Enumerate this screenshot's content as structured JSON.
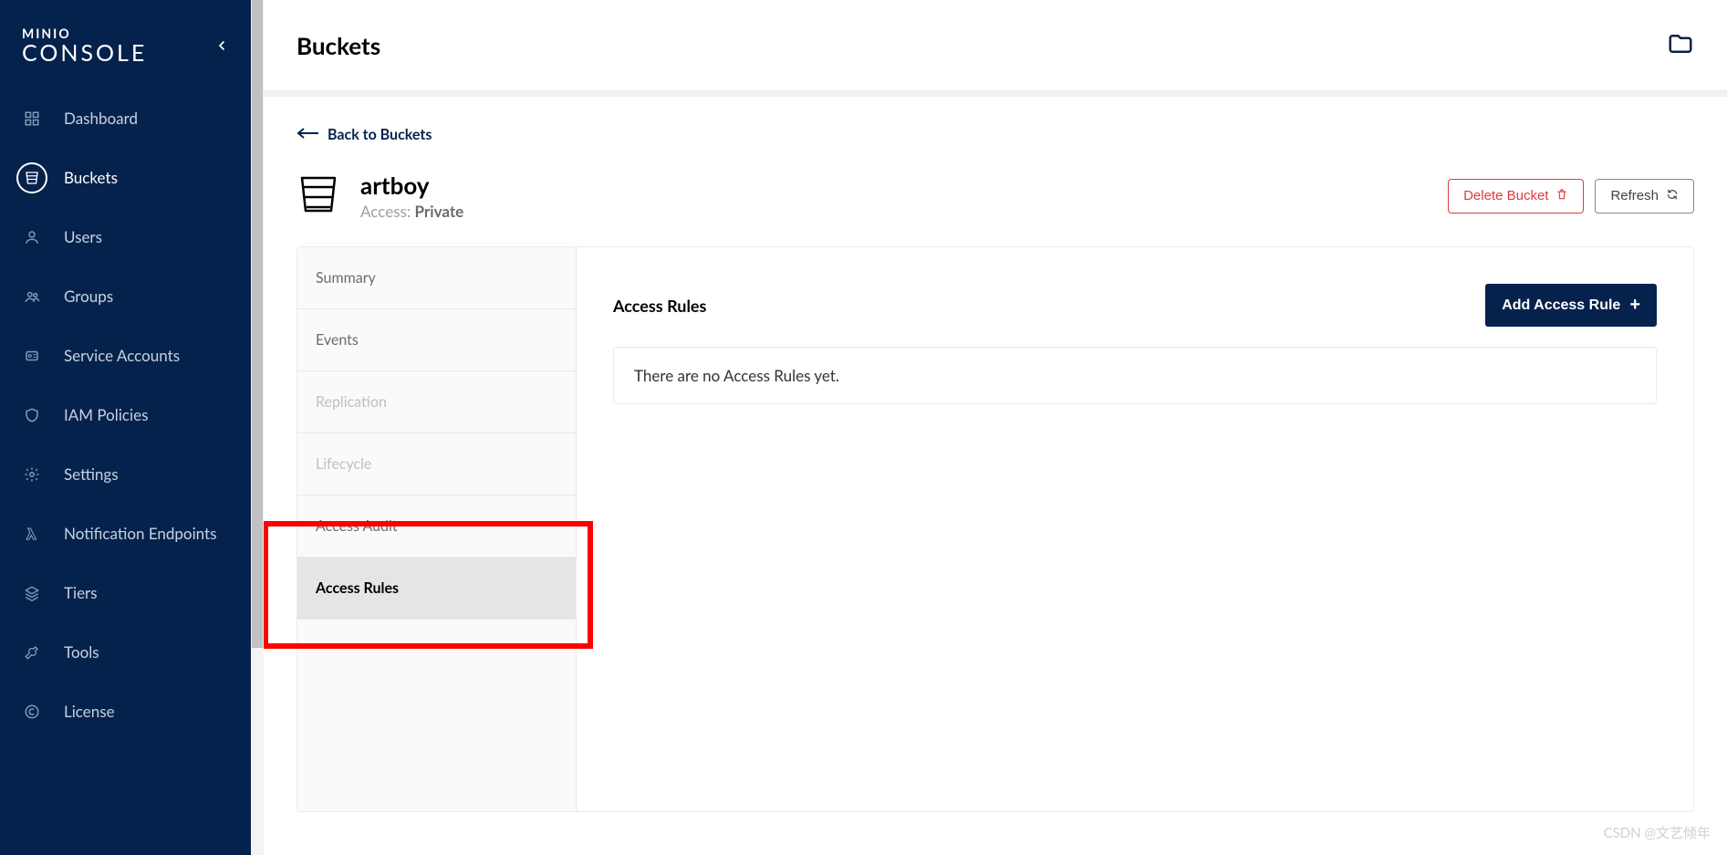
{
  "logo": {
    "brand": "MINIO",
    "product": "CONSOLE"
  },
  "nav": {
    "items": [
      {
        "label": "Dashboard"
      },
      {
        "label": "Buckets"
      },
      {
        "label": "Users"
      },
      {
        "label": "Groups"
      },
      {
        "label": "Service Accounts"
      },
      {
        "label": "IAM Policies"
      },
      {
        "label": "Settings"
      },
      {
        "label": "Notification Endpoints"
      },
      {
        "label": "Tiers"
      },
      {
        "label": "Tools"
      },
      {
        "label": "License"
      }
    ],
    "active_index": 1
  },
  "header": {
    "title": "Buckets"
  },
  "back": {
    "label": "Back to Buckets"
  },
  "bucket": {
    "name": "artboy",
    "access_label": "Access:",
    "access_value": "Private"
  },
  "actions": {
    "delete": "Delete Bucket",
    "refresh": "Refresh"
  },
  "tabs": [
    {
      "label": "Summary",
      "state": "normal"
    },
    {
      "label": "Events",
      "state": "normal"
    },
    {
      "label": "Replication",
      "state": "disabled"
    },
    {
      "label": "Lifecycle",
      "state": "disabled"
    },
    {
      "label": "Access Audit",
      "state": "normal"
    },
    {
      "label": "Access Rules",
      "state": "active"
    }
  ],
  "section": {
    "title": "Access Rules",
    "add_button": "Add Access Rule",
    "empty_text": "There are no Access Rules yet."
  },
  "watermark": "CSDN @文艺倾年"
}
